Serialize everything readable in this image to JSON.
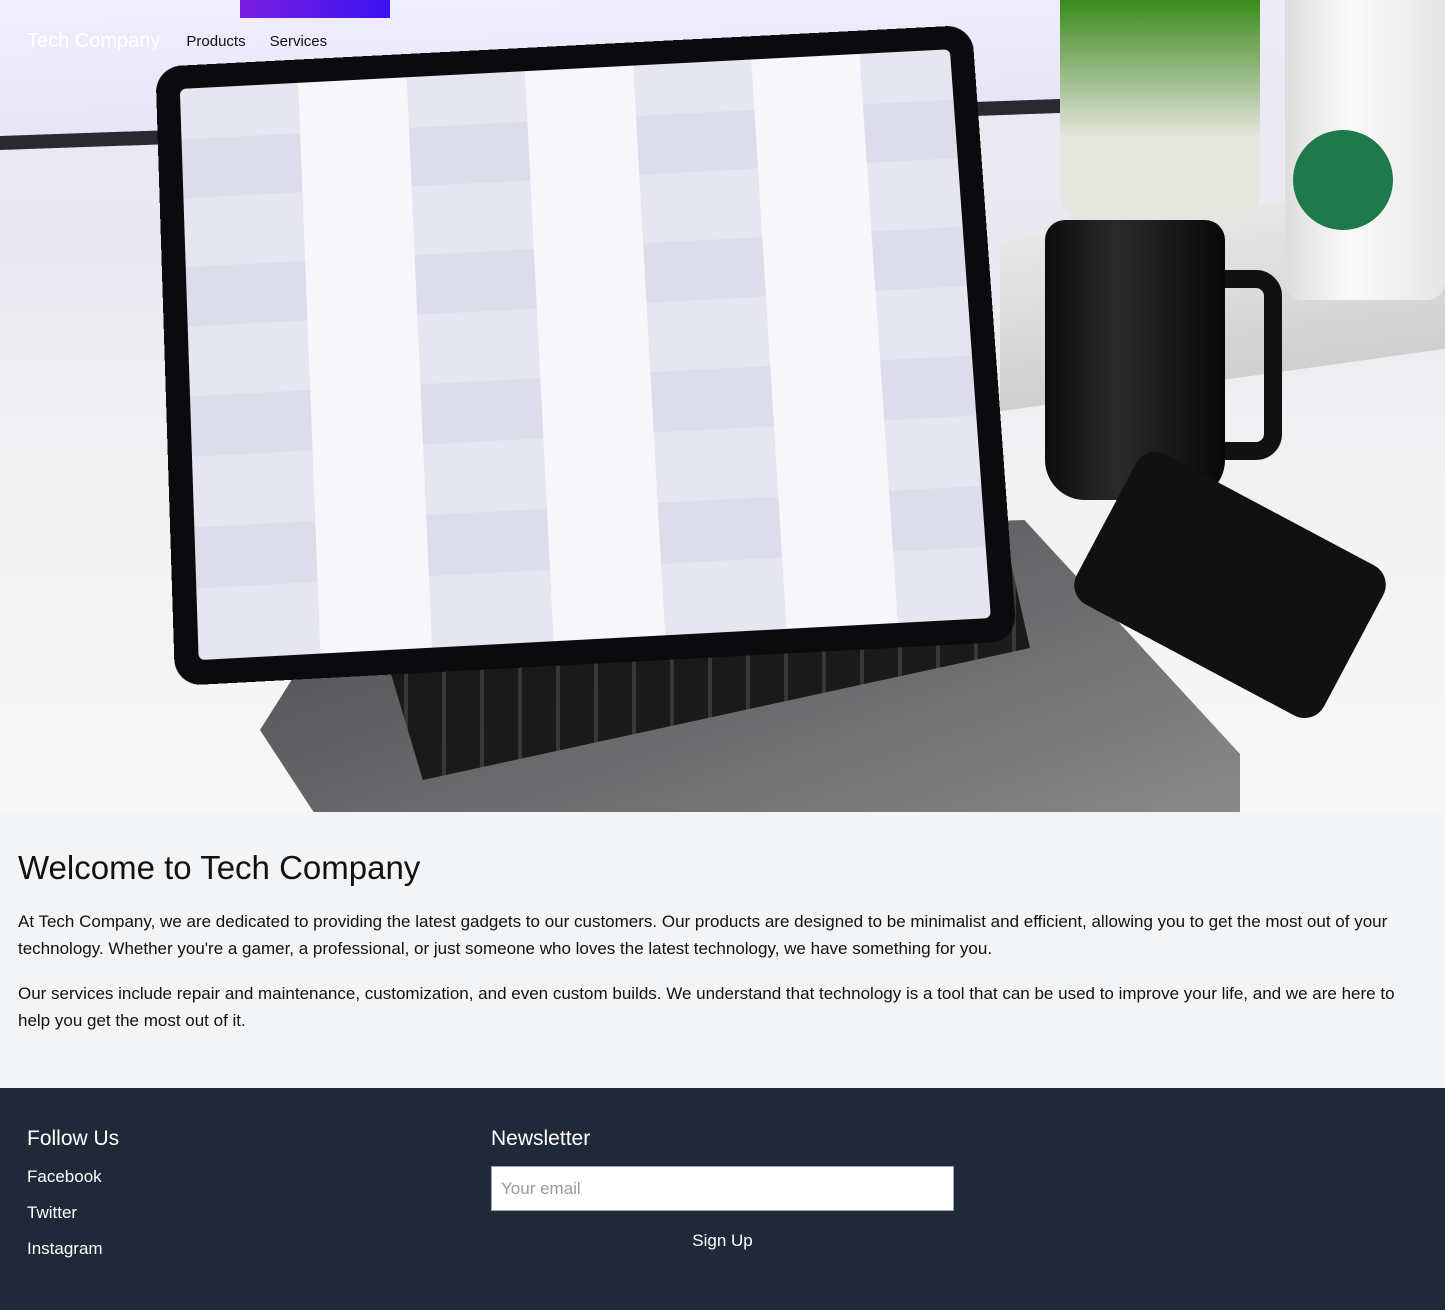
{
  "nav": {
    "brand": "Tech Company",
    "links": [
      "Products",
      "Services"
    ]
  },
  "hero": {
    "image_description_icon": "hero-photo-laptop-desk"
  },
  "main": {
    "title": "Welcome to Tech Company",
    "paragraphs": [
      "At Tech Company, we are dedicated to providing the latest gadgets to our customers. Our products are designed to be minimalist and efficient, allowing you to get the most out of your technology. Whether you're a gamer, a professional, or just someone who loves the latest technology, we have something for you.",
      "Our services include repair and maintenance, customization, and even custom builds. We understand that technology is a tool that can be used to improve your life, and we are here to help you get the most out of it."
    ]
  },
  "footer": {
    "follow_title": "Follow Us",
    "social": [
      "Facebook",
      "Twitter",
      "Instagram"
    ],
    "newsletter_title": "Newsletter",
    "email_placeholder": "Your email",
    "signup_label": "Sign Up"
  },
  "colors": {
    "footer_bg": "#1f2937",
    "page_bg": "#f3f4f6"
  }
}
